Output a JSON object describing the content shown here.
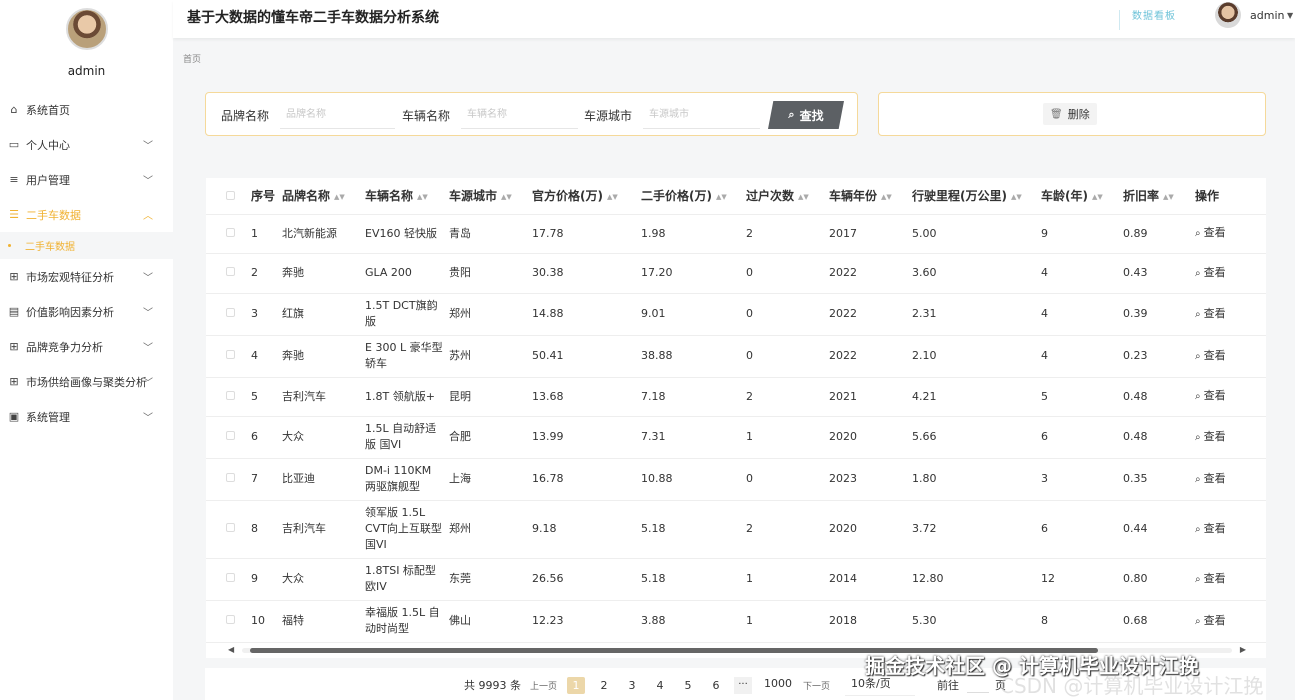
{
  "app": {
    "title": "基于大数据的懂车帝二手车数据分析系统",
    "dashboard_link": "数据看板",
    "user": "admin"
  },
  "sidebar": {
    "profile_name": "admin",
    "items": [
      {
        "label": "系统首页",
        "icon": "home-icon",
        "glyph": "⌂",
        "chevron": false
      },
      {
        "label": "个人中心",
        "icon": "card-icon",
        "glyph": "▭",
        "chevron": true
      },
      {
        "label": "用户管理",
        "icon": "list-icon",
        "glyph": "≡",
        "chevron": true
      },
      {
        "label": "二手车数据",
        "icon": "list-icon",
        "glyph": "☰",
        "chevron": true,
        "active": true
      },
      {
        "label": "市场宏观特征分析",
        "icon": "grid-icon",
        "glyph": "⊞",
        "chevron": true
      },
      {
        "label": "价值影响因素分析",
        "icon": "document-icon",
        "glyph": "▤",
        "chevron": true
      },
      {
        "label": "品牌竞争力分析",
        "icon": "grid-icon",
        "glyph": "⊞",
        "chevron": true
      },
      {
        "label": "市场供给画像与聚类分析",
        "icon": "grid-icon",
        "glyph": "⊞",
        "chevron": true
      },
      {
        "label": "系统管理",
        "icon": "clipboard-icon",
        "glyph": "▣",
        "chevron": true
      }
    ],
    "submenu": "二手车数据"
  },
  "breadcrumb": "首页",
  "search": {
    "brand_label": "品牌名称",
    "brand_placeholder": "品牌名称",
    "model_label": "车辆名称",
    "model_placeholder": "车辆名称",
    "city_label": "车源城市",
    "city_placeholder": "车源城市",
    "button": "查找"
  },
  "actions": {
    "delete": "删除"
  },
  "table": {
    "headers": [
      "序号",
      "品牌名称",
      "车辆名称",
      "车源城市",
      "官方价格(万)",
      "二手价格(万)",
      "过户次数",
      "车辆年份",
      "行驶里程(万公里)",
      "车龄(年)",
      "折旧率",
      "操作"
    ],
    "view_label": "查看",
    "rows": [
      {
        "no": "1",
        "brand": "北汽新能源",
        "model": "EV160 轻快版",
        "city": "青岛",
        "official": "17.78",
        "used": "1.98",
        "transfers": "2",
        "year": "2017",
        "mileage": "5.00",
        "age": "9",
        "rate": "0.89"
      },
      {
        "no": "2",
        "brand": "奔驰",
        "model": "GLA 200",
        "city": "贵阳",
        "official": "30.38",
        "used": "17.20",
        "transfers": "0",
        "year": "2022",
        "mileage": "3.60",
        "age": "4",
        "rate": "0.43"
      },
      {
        "no": "3",
        "brand": "红旗",
        "model": "1.5T DCT旗韵版",
        "city": "郑州",
        "official": "14.88",
        "used": "9.01",
        "transfers": "0",
        "year": "2022",
        "mileage": "2.31",
        "age": "4",
        "rate": "0.39"
      },
      {
        "no": "4",
        "brand": "奔驰",
        "model": "E 300 L 豪华型 轿车",
        "city": "苏州",
        "official": "50.41",
        "used": "38.88",
        "transfers": "0",
        "year": "2022",
        "mileage": "2.10",
        "age": "4",
        "rate": "0.23"
      },
      {
        "no": "5",
        "brand": "吉利汽车",
        "model": "1.8T 领航版+",
        "city": "昆明",
        "official": "13.68",
        "used": "7.18",
        "transfers": "2",
        "year": "2021",
        "mileage": "4.21",
        "age": "5",
        "rate": "0.48"
      },
      {
        "no": "6",
        "brand": "大众",
        "model": "1.5L 自动舒适版 国VI",
        "city": "合肥",
        "official": "13.99",
        "used": "7.31",
        "transfers": "1",
        "year": "2020",
        "mileage": "5.66",
        "age": "6",
        "rate": "0.48"
      },
      {
        "no": "7",
        "brand": "比亚迪",
        "model": "DM-i 110KM 两驱旗舰型",
        "city": "上海",
        "official": "16.78",
        "used": "10.88",
        "transfers": "0",
        "year": "2023",
        "mileage": "1.80",
        "age": "3",
        "rate": "0.35"
      },
      {
        "no": "8",
        "brand": "吉利汽车",
        "model": "领军版 1.5L CVT向上互联型 国VI",
        "city": "郑州",
        "official": "9.18",
        "used": "5.18",
        "transfers": "2",
        "year": "2020",
        "mileage": "3.72",
        "age": "6",
        "rate": "0.44"
      },
      {
        "no": "9",
        "brand": "大众",
        "model": "1.8TSI 标配型 欧IV",
        "city": "东莞",
        "official": "26.56",
        "used": "5.18",
        "transfers": "1",
        "year": "2014",
        "mileage": "12.80",
        "age": "12",
        "rate": "0.80"
      },
      {
        "no": "10",
        "brand": "福特",
        "model": "幸福版 1.5L 自动时尚型",
        "city": "佛山",
        "official": "12.23",
        "used": "3.88",
        "transfers": "1",
        "year": "2018",
        "mileage": "5.30",
        "age": "8",
        "rate": "0.68"
      }
    ]
  },
  "pagination": {
    "total": "共 9993 条",
    "prev": "上一页",
    "pages": [
      "1",
      "2",
      "3",
      "4",
      "5",
      "6"
    ],
    "current": "1",
    "ellipsis": "···",
    "last": "1000",
    "next": "下一页",
    "page_size": "10条/页",
    "goto": "前往",
    "page_unit": "页"
  },
  "watermark": "掘金技术社区 @ 计算机毕业设计江挽",
  "watermark_faint": "CSDN @计算机毕业设计江挽"
}
